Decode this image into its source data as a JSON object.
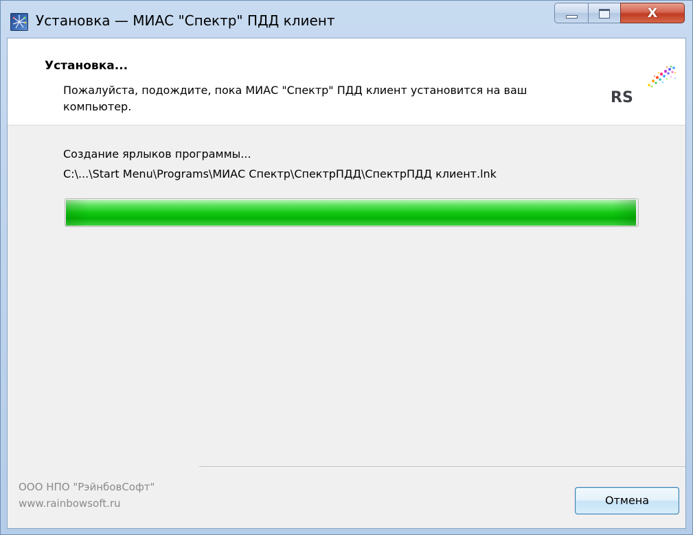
{
  "window": {
    "title": "Установка — МИАС \"Спектр\" ПДД клиент",
    "close_glyph": "X"
  },
  "header": {
    "title": "Установка...",
    "subtitle": "Пожалуйста, подождите, пока МИАС \"Спектр\" ПДД клиент установится на ваш компьютер.",
    "logo_text": "RS"
  },
  "progress": {
    "status": "Создание ярлыков программы...",
    "current_path": "C:\\...\\Start Menu\\Programs\\МИАС Спектр\\СпектрПДД\\СпектрПДД клиент.lnk",
    "percent": 99.7,
    "bar_color": "#13c913"
  },
  "footer": {
    "company_name": "ООО НПО \"РэйнбовСофт\"",
    "company_url": "www.rainbowsoft.ru",
    "cancel_label": "Отмена"
  },
  "colors": {
    "window_frame": "#b5cde9",
    "client_background": "#f0f0f0",
    "close_button": "#c13b23",
    "company_text": "#8a8a8a"
  },
  "icons": {
    "app": "installer-app-icon",
    "minimize": "minimize-icon",
    "maximize": "maximize-icon",
    "close": "close-icon",
    "logo": "rainbowsoft-logo"
  }
}
